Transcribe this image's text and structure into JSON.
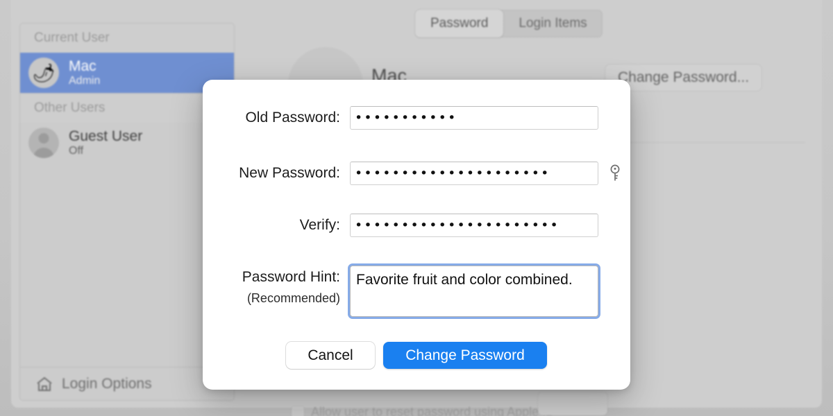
{
  "window": {
    "tabs": [
      {
        "label": "Password",
        "selected": true
      },
      {
        "label": "Login Items",
        "selected": false
      }
    ]
  },
  "sidebar": {
    "sections": [
      {
        "header": "Current User",
        "items": [
          {
            "name": "Mac",
            "role": "Admin",
            "avatar": "chili-pepper-avatar",
            "selected": true
          }
        ]
      },
      {
        "header": "Other Users",
        "items": [
          {
            "name": "Guest User",
            "role": "Off",
            "avatar": "person-silhouette-avatar",
            "selected": false
          }
        ]
      }
    ],
    "footer": {
      "label": "Login Options",
      "icon": "home-icon"
    }
  },
  "account": {
    "name": "Mac",
    "change_password_button": "Change Password...",
    "allow_checkbox_label": "Allow user to reset password using Apple ID"
  },
  "dialog": {
    "fields": [
      {
        "label": "Old Password:",
        "value": "•••••••••••",
        "dot_count": 11
      },
      {
        "label": "New Password:",
        "value": "•••••••••••••••••••••",
        "dot_count": 21
      },
      {
        "label": "Verify:",
        "value": "••••••••••••••••••••••",
        "dot_count": 22
      }
    ],
    "hint": {
      "label": "Password Hint:",
      "sublabel": "(Recommended)",
      "value": "Favorite fruit and color combined.",
      "focused": true
    },
    "key_button": "password-assistant-key-icon",
    "buttons": {
      "cancel": "Cancel",
      "confirm": "Change Password"
    }
  },
  "colors": {
    "accent_blue": "#1a80f0",
    "selection_blue": "#6d8ed2",
    "focus_ring": "#86abe8",
    "window_gray": "#cfcfcf"
  }
}
